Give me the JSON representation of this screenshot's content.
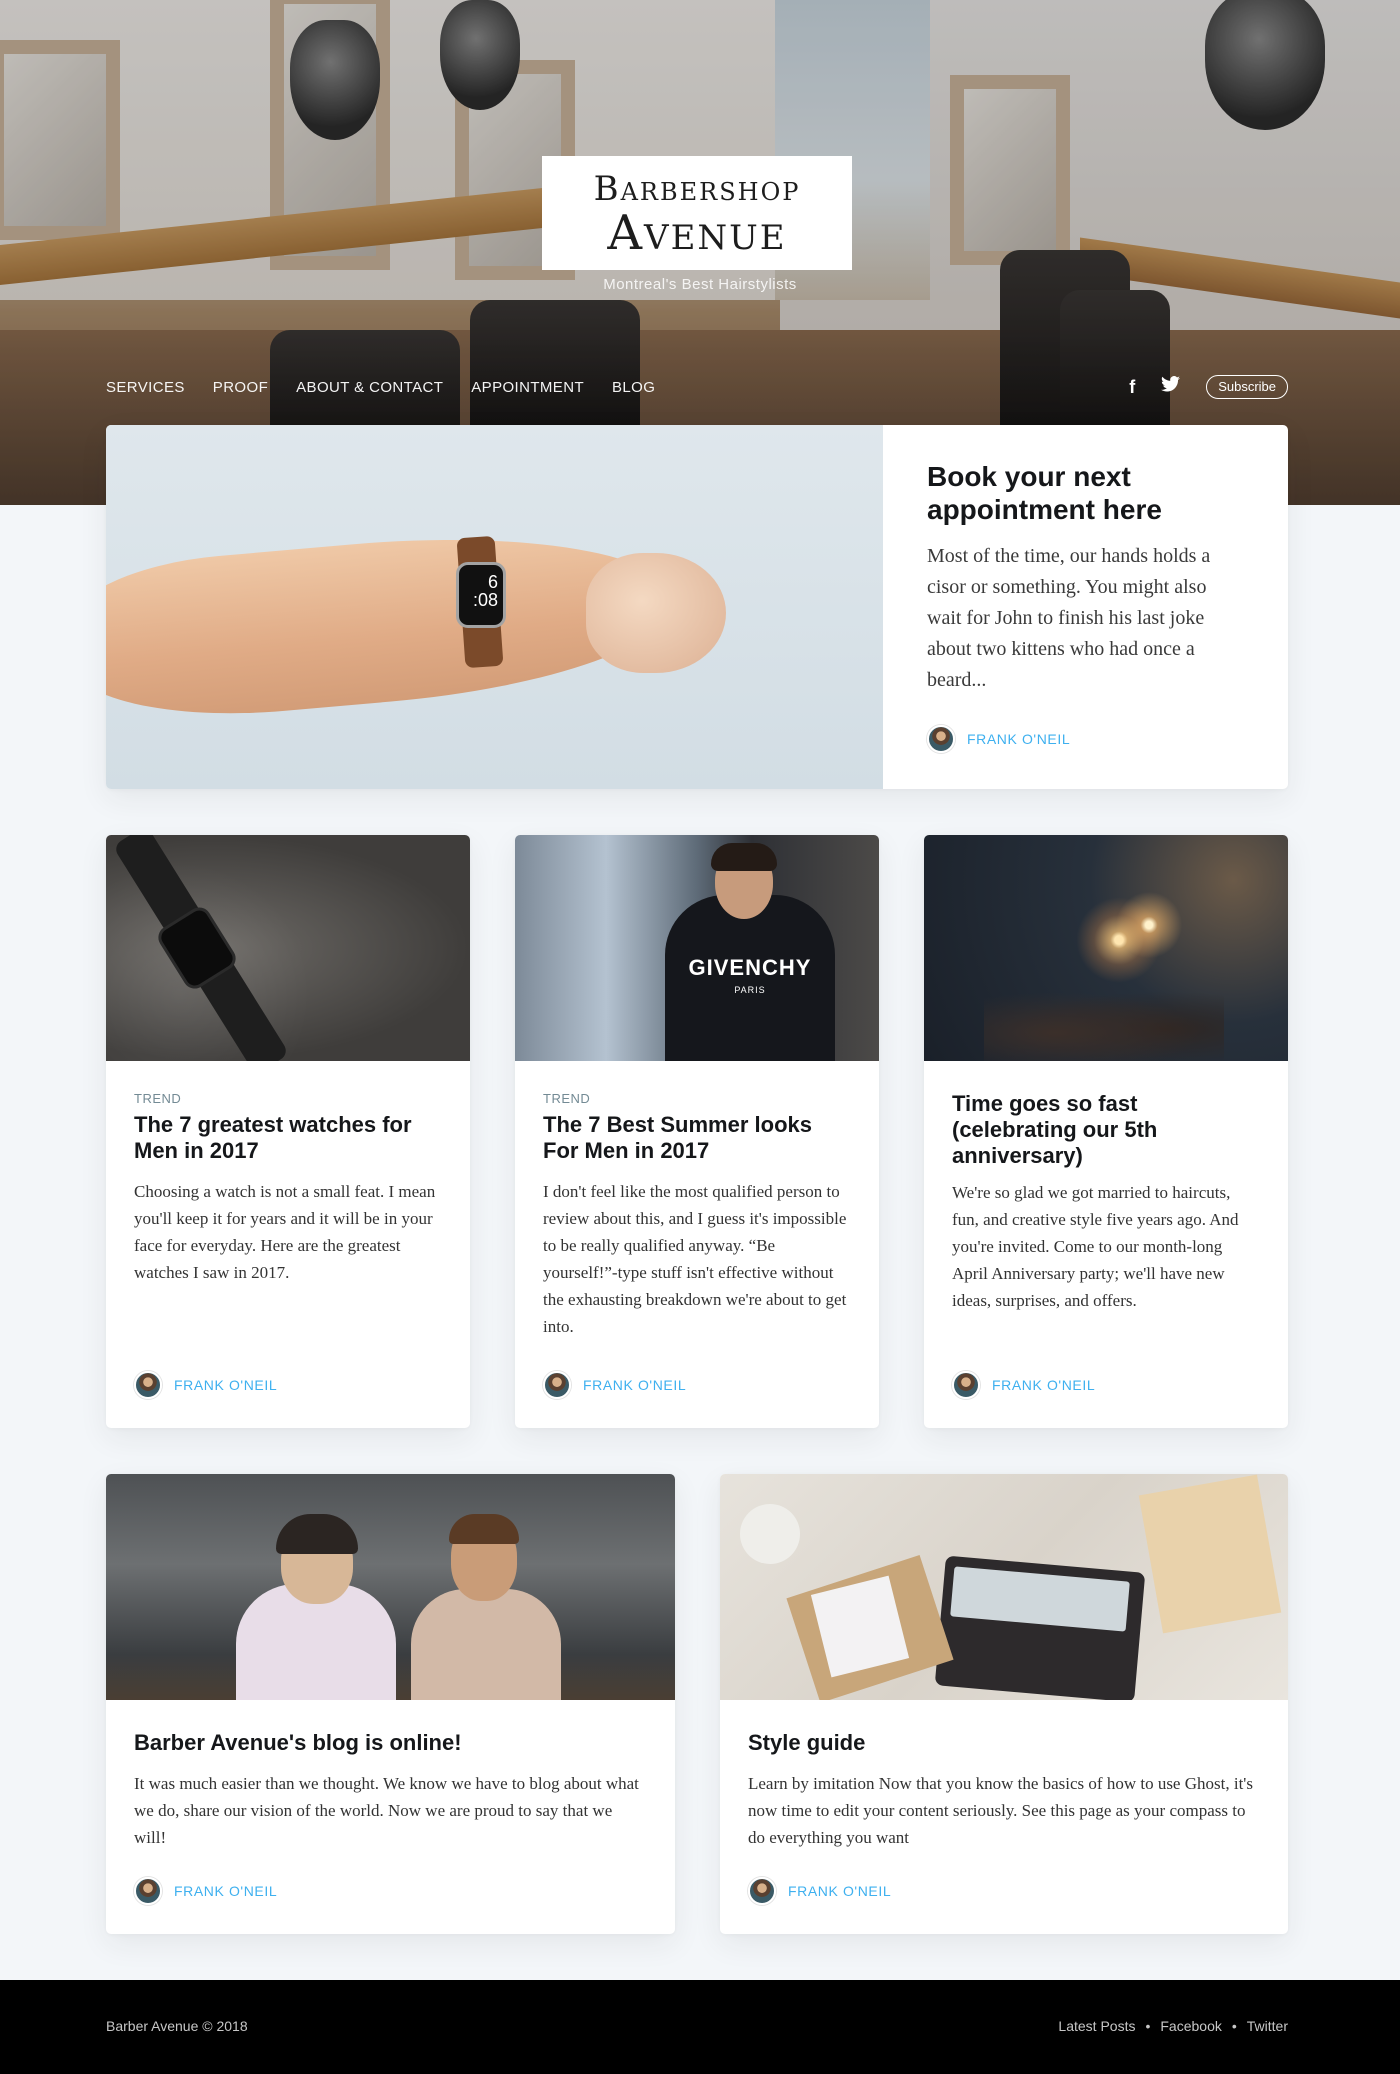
{
  "site": {
    "logo_line1": "Barbershop",
    "logo_line2": "Avenue",
    "tagline": "Montreal's Best Hairstylists"
  },
  "nav": {
    "items": [
      "SERVICES",
      "PROOF",
      "ABOUT & CONTACT",
      "APPOINTMENT",
      "BLOG"
    ],
    "social": [
      "facebook-icon",
      "twitter-icon"
    ],
    "subscribe_label": "Subscribe"
  },
  "featured": {
    "title": "Book your next appointment here",
    "excerpt": "Most of the time, our hands holds a cisor or something. You might also wait for John to finish his last joke about two kittens who had once a beard...",
    "author": "FRANK O'NEIL",
    "watch_time_1": "6",
    "watch_time_2": ":08"
  },
  "posts": [
    {
      "tag": "TREND",
      "title": "The 7 greatest watches for Men in 2017",
      "excerpt": "Choosing a watch is not a small feat. I mean you'll keep it for years and it will be in your face for everyday. Here are the greatest watches I saw in 2017.",
      "author": "FRANK O'NEIL"
    },
    {
      "tag": "TREND",
      "title": "The 7 Best Summer looks For Men in 2017",
      "excerpt": "I don't feel like the most qualified person to review about this, and I guess it's impossible to be really qualified anyway. “Be yourself!”-type stuff isn't effective without the exhausting breakdown we're about to get into.",
      "author": "FRANK O'NEIL",
      "shirt_text": "GIVENCHY",
      "shirt_sub": "PARIS"
    },
    {
      "tag": "",
      "title": "Time goes so fast (celebrating our 5th anniversary)",
      "excerpt": "We're so glad we got married to haircuts, fun, and creative style five years ago. And you're invited. Come to our month-long April Anniversary party; we'll have new ideas, surprises, and offers.",
      "author": "FRANK O'NEIL"
    },
    {
      "tag": "",
      "title": "Barber Avenue's blog is online!",
      "excerpt": "It was much easier than we thought. We know we have to blog about what we do, share our vision of the world. Now we are proud to say that we will!",
      "author": "FRANK O'NEIL"
    },
    {
      "tag": "",
      "title": "Style guide",
      "excerpt": "Learn by imitation Now that you know the basics of how to use Ghost, it's now time to edit your content seriously. See this page as your compass to do everything you want",
      "author": "FRANK O'NEIL"
    }
  ],
  "footer": {
    "copyright": "Barber Avenue © 2018",
    "links": [
      "Latest Posts",
      "Facebook",
      "Twitter"
    ],
    "separator": "•"
  },
  "colors": {
    "accent": "#3eb0ef",
    "background": "#f3f6f9",
    "footer": "#000000"
  }
}
